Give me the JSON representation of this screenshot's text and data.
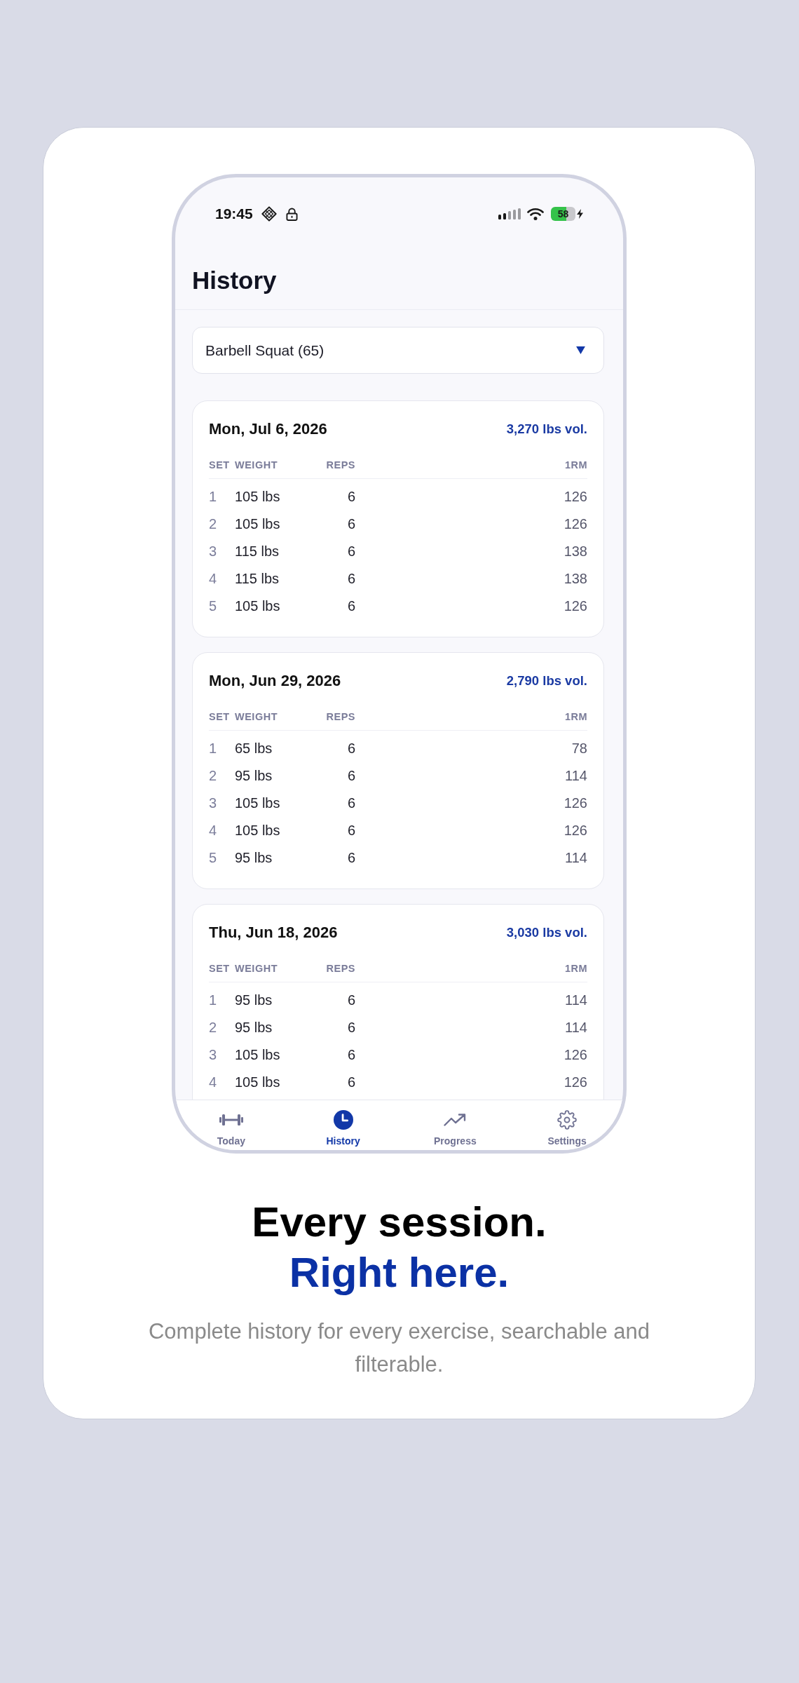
{
  "status_bar": {
    "time": "19:45",
    "battery": "58"
  },
  "header": {
    "title": "History"
  },
  "exercise_picker": {
    "value": "Barbell Squat (65)"
  },
  "sessions": [
    {
      "date": "Mon, Jul 6, 2026",
      "volume": "3,270 lbs vol.",
      "columns": [
        "SET",
        "WEIGHT",
        "REPS",
        "1RM"
      ],
      "sets": [
        {
          "set": "1",
          "weight": "105 lbs",
          "reps": "6",
          "one_rm": "126"
        },
        {
          "set": "2",
          "weight": "105 lbs",
          "reps": "6",
          "one_rm": "126"
        },
        {
          "set": "3",
          "weight": "115 lbs",
          "reps": "6",
          "one_rm": "138"
        },
        {
          "set": "4",
          "weight": "115 lbs",
          "reps": "6",
          "one_rm": "138"
        },
        {
          "set": "5",
          "weight": "105 lbs",
          "reps": "6",
          "one_rm": "126"
        }
      ]
    },
    {
      "date": "Mon, Jun 29, 2026",
      "volume": "2,790 lbs vol.",
      "columns": [
        "SET",
        "WEIGHT",
        "REPS",
        "1RM"
      ],
      "sets": [
        {
          "set": "1",
          "weight": "65 lbs",
          "reps": "6",
          "one_rm": "78"
        },
        {
          "set": "2",
          "weight": "95 lbs",
          "reps": "6",
          "one_rm": "114"
        },
        {
          "set": "3",
          "weight": "105 lbs",
          "reps": "6",
          "one_rm": "126"
        },
        {
          "set": "4",
          "weight": "105 lbs",
          "reps": "6",
          "one_rm": "126"
        },
        {
          "set": "5",
          "weight": "95 lbs",
          "reps": "6",
          "one_rm": "114"
        }
      ]
    },
    {
      "date": "Thu, Jun 18, 2026",
      "volume": "3,030 lbs vol.",
      "columns": [
        "SET",
        "WEIGHT",
        "REPS",
        "1RM"
      ],
      "sets": [
        {
          "set": "1",
          "weight": "95 lbs",
          "reps": "6",
          "one_rm": "114"
        },
        {
          "set": "2",
          "weight": "95 lbs",
          "reps": "6",
          "one_rm": "114"
        },
        {
          "set": "3",
          "weight": "105 lbs",
          "reps": "6",
          "one_rm": "126"
        },
        {
          "set": "4",
          "weight": "105 lbs",
          "reps": "6",
          "one_rm": "126"
        }
      ]
    }
  ],
  "tabs": [
    {
      "label": "Today",
      "selected": false
    },
    {
      "label": "History",
      "selected": true
    },
    {
      "label": "Progress",
      "selected": false
    },
    {
      "label": "Settings",
      "selected": false
    }
  ],
  "hero": {
    "title": "Every session.",
    "accent": "Right here.",
    "subtitle": "Complete history for every exercise, searchable and filterable."
  }
}
